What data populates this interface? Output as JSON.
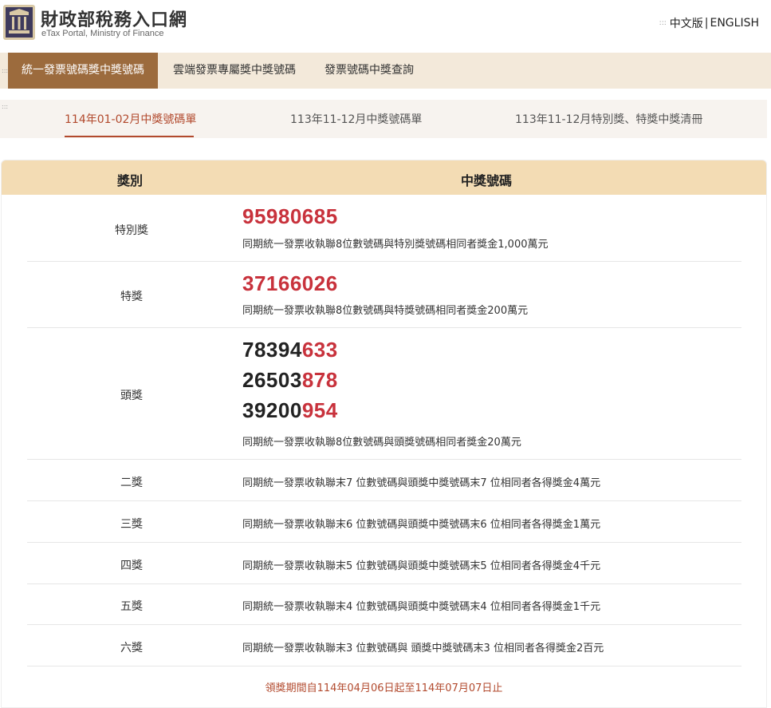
{
  "header": {
    "title": "財政部稅務入口網",
    "subtitle": "eTax Portal, Ministry of Finance",
    "lang_chinese": "中文版",
    "lang_separator": "|",
    "lang_english": "ENGLISH"
  },
  "main_nav": {
    "tabs": [
      {
        "label": "統一發票號碼獎中獎號碼"
      },
      {
        "label": "雲端發票專屬獎中獎號碼"
      },
      {
        "label": "發票號碼中獎查詢"
      }
    ]
  },
  "sub_nav": {
    "tabs": [
      {
        "label": "114年01-02月中獎號碼單"
      },
      {
        "label": "113年11-12月中獎號碼單"
      },
      {
        "label": "113年11-12月特別獎、特獎中獎清冊"
      }
    ]
  },
  "table": {
    "headers": {
      "prize": "獎別",
      "numbers": "中獎號碼"
    },
    "special": {
      "name": "特別獎",
      "number": "95980685",
      "desc": "同期統一發票收執聯8位數號碼與特別獎號碼相同者獎金1,000萬元"
    },
    "grand": {
      "name": "特獎",
      "number": "37166026",
      "desc": "同期統一發票收執聯8位數號碼與特獎號碼相同者獎金200萬元"
    },
    "first": {
      "name": "頭獎",
      "numbers": [
        {
          "prefix": "78394",
          "suffix": "633"
        },
        {
          "prefix": "26503",
          "suffix": "878"
        },
        {
          "prefix": "39200",
          "suffix": "954"
        }
      ],
      "desc": "同期統一發票收執聯8位數號碼與頭獎號碼相同者獎金20萬元"
    },
    "second": {
      "name": "二獎",
      "desc": "同期統一發票收執聯末7 位數號碼與頭獎中獎號碼末7 位相同者各得獎金4萬元"
    },
    "third": {
      "name": "三獎",
      "desc": "同期統一發票收執聯末6 位數號碼與頭獎中獎號碼末6 位相同者各得獎金1萬元"
    },
    "fourth": {
      "name": "四獎",
      "desc": "同期統一發票收執聯末5 位數號碼與頭獎中獎號碼末5 位相同者各得獎金4千元"
    },
    "fifth": {
      "name": "五獎",
      "desc": "同期統一發票收執聯末4 位數號碼與頭獎中獎號碼末4 位相同者各得獎金1千元"
    },
    "sixth": {
      "name": "六獎",
      "desc": "同期統一發票收執聯末3 位數號碼與 頭獎中獎號碼末3 位相同者各得獎金2百元"
    },
    "claim_period": "領獎期間自114年04月06日起至114年07月07日止"
  },
  "colors": {
    "accent_brown": "#9c6b3d",
    "nav_bg": "#f3e9da",
    "table_header_bg": "#f3dcb4",
    "winning_red": "#c8323c",
    "active_tab_red": "#b24a2e"
  }
}
